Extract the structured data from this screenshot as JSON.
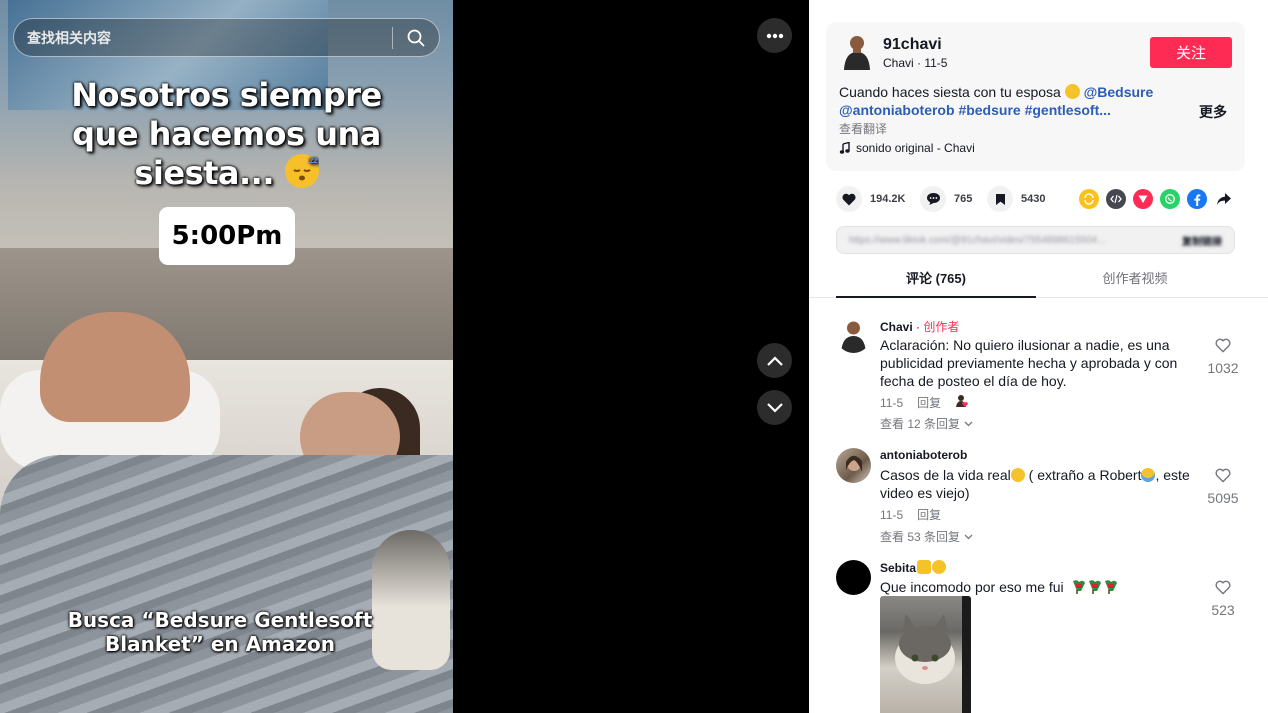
{
  "search": {
    "placeholder": "查找相关内容"
  },
  "video": {
    "caption_lines": [
      "Nosotros siempre",
      "que hacemos una",
      "siesta... "
    ],
    "time_label": "5:00Pm",
    "bottom_caption_lines": [
      "Busca “Bedsure Gentlesoft",
      "Blanket” en Amazon"
    ]
  },
  "post": {
    "username": "91chavi",
    "nickname_date": "Chavi · 11-5",
    "follow_label": "关注",
    "description_text": "Cuando haces siesta con tu esposa ",
    "mention_1": "@Bedsure",
    "mention_2": "@antoniaboterob",
    "hashtags": "#bedsure #gentlesoft...",
    "more_label": "更多",
    "translate_label": "查看翻译",
    "music": "sonido original - Chavi"
  },
  "actions": {
    "likes": "194.2K",
    "comments": "765",
    "saves": "5430",
    "share_icons": [
      "repost-icon",
      "embed-icon",
      "send-icon",
      "whatsapp-icon",
      "facebook-icon",
      "share-arrow-icon"
    ]
  },
  "link": {
    "url": "https://www.tiktok.com/@91chavi/video/7554898615504...",
    "copy_label": "复制链接"
  },
  "tabs": [
    {
      "label": "评论 (765)",
      "active": true
    },
    {
      "label": "创作者视频",
      "active": false
    }
  ],
  "comments": [
    {
      "user": "Chavi",
      "tag": "创作者",
      "text": "Aclaración: No quiero ilusionar a nadie, es una publicidad previamente hecha y aprobada y con fecha de posteo el día de hoy.",
      "date": "11-5",
      "reply_label": "回复",
      "view_replies": "查看 12 条回复",
      "likes": "1032"
    },
    {
      "user": "antoniaboterob",
      "text_a": "Casos de la vida real",
      "text_b": " ( extraño a Robert",
      "text_c": ", este video es viejo)",
      "date": "11-5",
      "reply_label": "回复",
      "view_replies": "查看 53 条回复",
      "likes": "5095"
    },
    {
      "user": "Sebita",
      "text": "Que incomodo por eso me fui",
      "likes": "523"
    }
  ],
  "colors": {
    "accent": "#fe2c55",
    "link": "#2b5db9",
    "text": "#161823",
    "muted": "#75777e"
  }
}
